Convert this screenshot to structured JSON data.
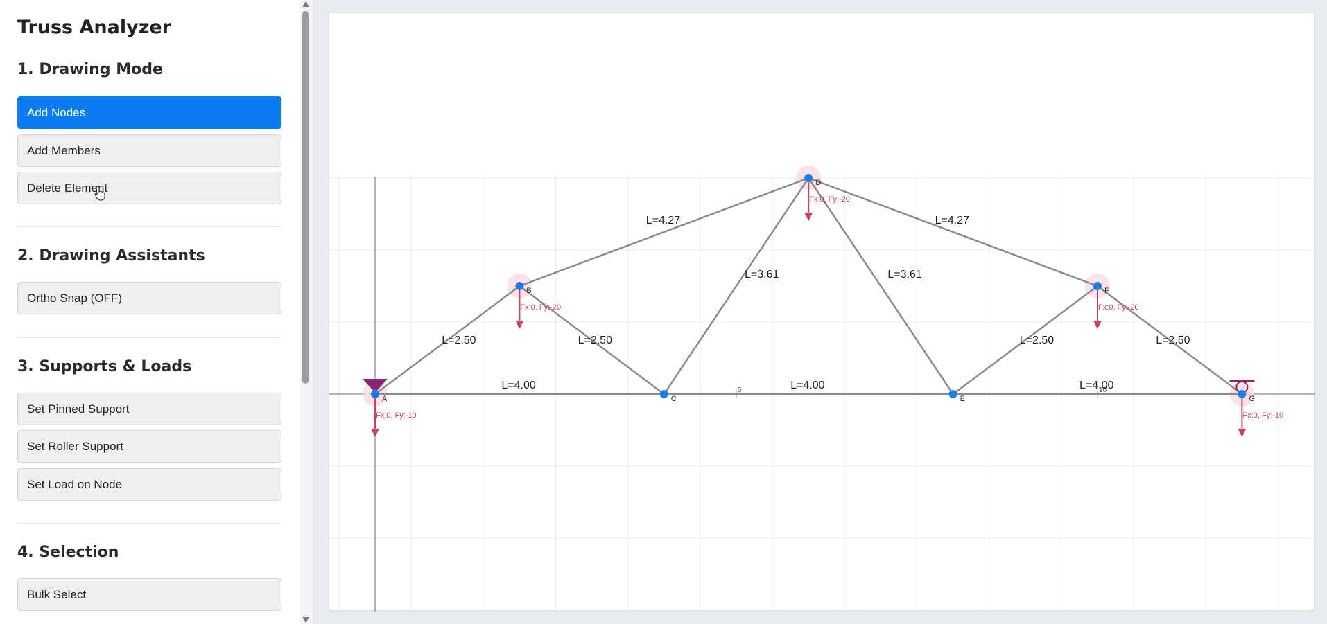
{
  "app": {
    "title": "Truss Analyzer"
  },
  "sections": {
    "drawing_mode": {
      "title": "1. Drawing Mode",
      "buttons": [
        "Add Nodes",
        "Add Members",
        "Delete Element"
      ]
    },
    "assistants": {
      "title": "2. Drawing Assistants",
      "buttons": [
        "Ortho Snap (OFF)"
      ]
    },
    "supports": {
      "title": "3. Supports & Loads",
      "buttons": [
        "Set Pinned Support",
        "Set Roller Support",
        "Set Load on Node"
      ]
    },
    "selection": {
      "title": "4. Selection",
      "buttons": [
        "Bulk Select"
      ]
    }
  },
  "colors": {
    "accent": "#0a7cf0",
    "node": "#1a7ee8",
    "member": "#8a8a8a",
    "load": "#c8415e",
    "support": "#8a2372"
  },
  "truss": {
    "nodes": [
      {
        "id": "A",
        "x": 0,
        "y": 0,
        "load": "Fx:0, Fy:-10",
        "support": "pinned"
      },
      {
        "id": "B",
        "x": 2,
        "y": 1.5,
        "load": "Fx:0, Fy:-20"
      },
      {
        "id": "C",
        "x": 4,
        "y": 0
      },
      {
        "id": "D",
        "x": 6,
        "y": 3,
        "load": "Fx:0, Fy:-20"
      },
      {
        "id": "E",
        "x": 8,
        "y": 0
      },
      {
        "id": "F",
        "x": 10,
        "y": 1.5,
        "load": "Fx:0, Fy:-20"
      },
      {
        "id": "G",
        "x": 12,
        "y": 0,
        "load": "Fx:0, Fy:-10",
        "support": "roller"
      }
    ],
    "members": [
      {
        "from": "A",
        "to": "C",
        "label": "L=4.00"
      },
      {
        "from": "C",
        "to": "E",
        "label": "L=4.00"
      },
      {
        "from": "E",
        "to": "G",
        "label": "L=4.00"
      },
      {
        "from": "A",
        "to": "B",
        "label": "L=2.50"
      },
      {
        "from": "B",
        "to": "C",
        "label": "L=2.50"
      },
      {
        "from": "B",
        "to": "D",
        "label": "L=4.27"
      },
      {
        "from": "C",
        "to": "D",
        "label": "L=3.61"
      },
      {
        "from": "D",
        "to": "E",
        "label": "L=3.61"
      },
      {
        "from": "D",
        "to": "F",
        "label": "L=4.27"
      },
      {
        "from": "E",
        "to": "F",
        "label": "L=2.50"
      },
      {
        "from": "F",
        "to": "G",
        "label": "L=2.50"
      }
    ],
    "axis_ticks": [
      {
        "x": 5,
        "label": "5"
      },
      {
        "x": 10,
        "label": "10"
      }
    ]
  }
}
